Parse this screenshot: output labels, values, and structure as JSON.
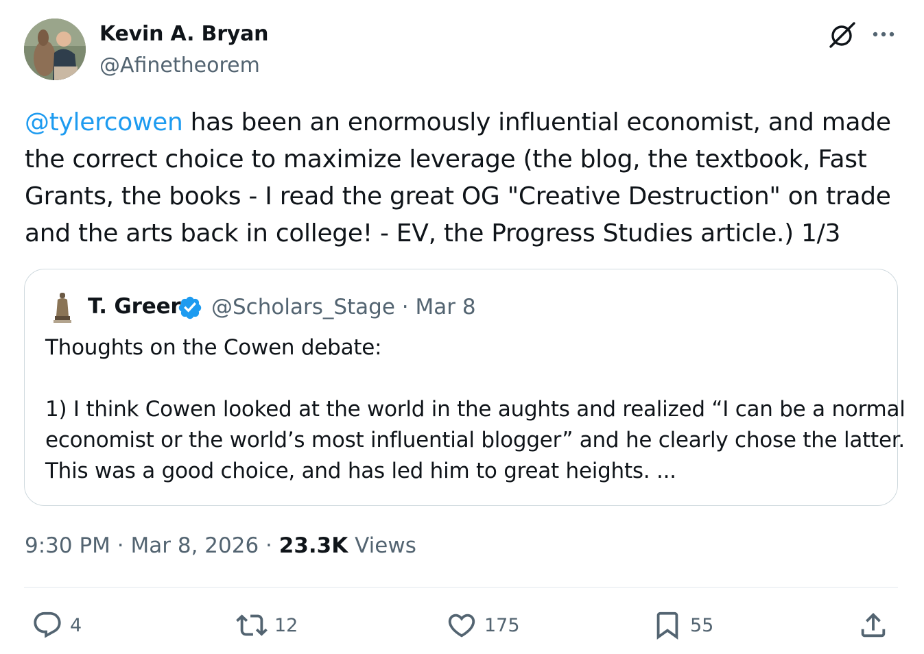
{
  "author": {
    "name": "Kevin A. Bryan",
    "handle": "@Afinetheorem"
  },
  "tweet": {
    "mention": "@tylercowen",
    "text": " has been an enormously influential economist, and made the correct choice to maximize leverage (the blog, the textbook, Fast Grants, the books - I read the great OG \"Creative Destruction\" on trade and the arts back in college! - EV, the Progress Studies article.) 1/3"
  },
  "quote": {
    "name": "T. Greer",
    "handle": "@Scholars_Stage",
    "separator": "·",
    "date": "Mar 8",
    "line1": "Thoughts on the Cowen debate:",
    "line2": "1) I think Cowen looked at the world in the aughts and realized “I can be a normal",
    "line3": "economist or the world’s most influential blogger” and he clearly chose the latter.",
    "line4": "This was a good choice, and has led him to great heights. ..."
  },
  "meta": {
    "time": "9:30 PM",
    "date": "Mar 8, 2026",
    "separator": "·",
    "views_count": "23.3K",
    "views_label": "Views"
  },
  "actions": {
    "replies": "4",
    "retweets": "12",
    "likes": "175",
    "bookmarks": "55"
  },
  "icons": [
    "grok-icon",
    "more-icon",
    "verified-icon",
    "reply-icon",
    "retweet-icon",
    "like-icon",
    "bookmark-icon",
    "share-icon"
  ],
  "colors": {
    "link": "#1d9bf0",
    "verified": "#1d9bf0",
    "text": "#0f1419",
    "secondary": "#536471"
  }
}
